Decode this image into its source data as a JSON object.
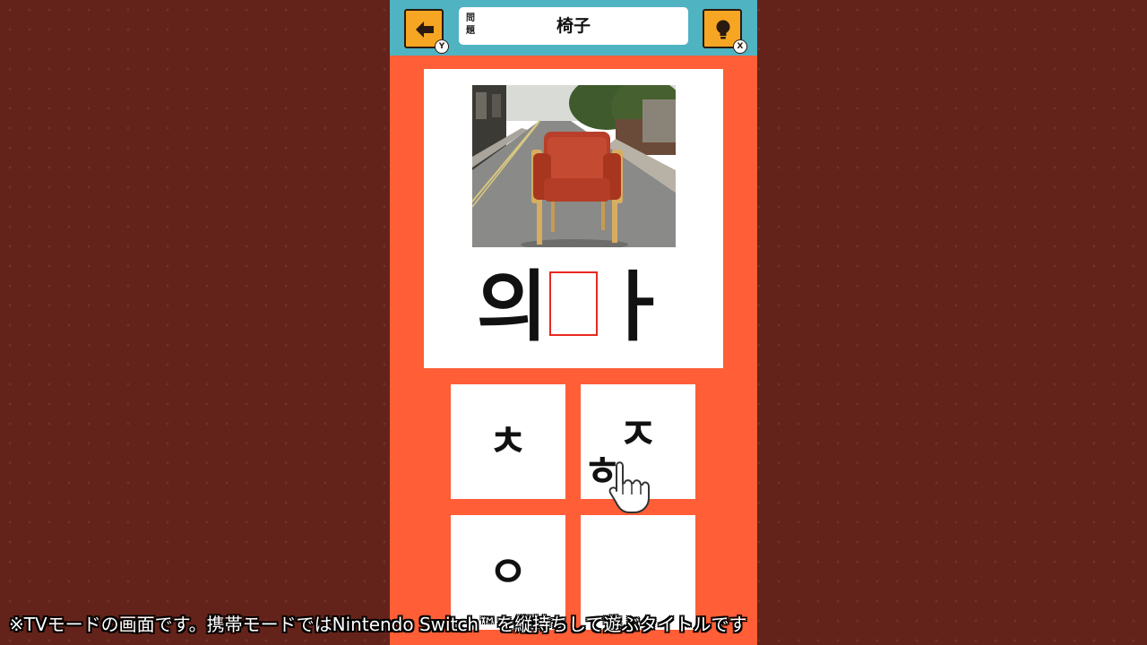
{
  "header": {
    "back_button": {
      "icon": "arrow-left-icon",
      "badge": "Y"
    },
    "hint_button": {
      "icon": "lightbulb-icon",
      "badge": "X"
    },
    "question_label": "問題",
    "question_word": "椅子"
  },
  "puzzle": {
    "image": "chair-in-street-photo",
    "word_before_blank": "의",
    "word_after_blank": "ㅏ"
  },
  "choices": [
    {
      "label": "ㅊ"
    },
    {
      "label": "ㅈ"
    },
    {
      "label": "ㅇ"
    },
    {
      "label": ""
    }
  ],
  "dragging": {
    "label": "ㅎ",
    "cursor": "pointing-hand-icon"
  },
  "caption": "※TVモードの画面です。携帯モードではNintendo Switch™を縦持ちして遊ぶタイトルです",
  "colors": {
    "background": "#64231a",
    "panel": "#ff5e36",
    "topbar": "#4fb3c2",
    "button": "#f7a623",
    "blank_border": "#e8281e"
  }
}
